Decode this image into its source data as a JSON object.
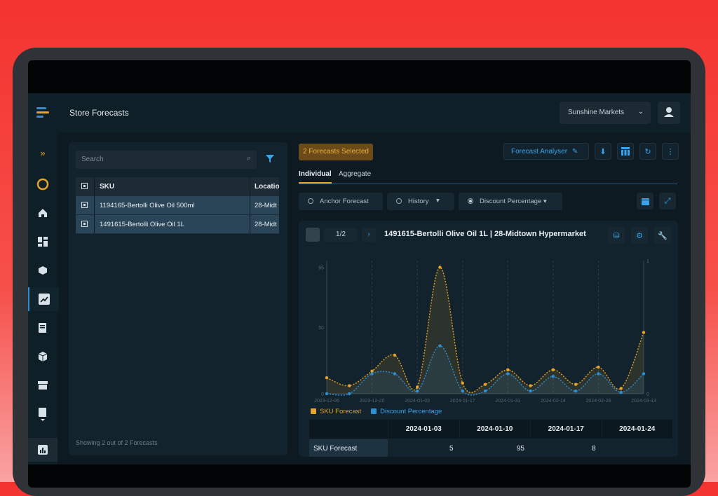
{
  "app": {
    "title": "Store Forecasts",
    "store": "Sunshine Markets"
  },
  "sidebar": {
    "items": [
      "expand-icon",
      "circle-logo-icon",
      "home-icon",
      "dashboard-icon",
      "inventory-icon",
      "forecast-icon",
      "document-icon",
      "box-icon",
      "store-icon",
      "report-icon",
      "analytics-icon"
    ],
    "active": "forecast-icon"
  },
  "left": {
    "search_placeholder": "Search",
    "columns": {
      "sku": "SKU",
      "location": "Locatio"
    },
    "rows": [
      {
        "sku": "1194165-Bertolli Olive Oil 500ml",
        "location": "28-Midt"
      },
      {
        "sku": "1491615-Bertolli Olive Oil 1L",
        "location": "28-Midt"
      }
    ],
    "footer": "Showing 2 out of 2 Forecasts"
  },
  "right": {
    "badge": "2 Forecasts Selected",
    "analyser": "Forecast Analyser",
    "tabs": {
      "individual": "Individual",
      "aggregate": "Aggregate"
    },
    "filters": {
      "anchor": "Anchor Forecast",
      "history": "History",
      "discount": "Discount Percentage"
    },
    "pager": "1/2",
    "chart_title": "1491615-Bertolli Olive Oil 1L | 28-Midtown Hypermarket",
    "legend": {
      "sku": "SKU Forecast",
      "discount": "Discount Percentage"
    },
    "table": {
      "dates": [
        "2024-01-03",
        "2024-01-10",
        "2024-01-17",
        "2024-01-24"
      ],
      "row_label": "SKU Forecast",
      "values": [
        "5",
        "95",
        "8",
        ""
      ]
    }
  },
  "colors": {
    "accent": "#38a4ee",
    "forecast": "#e6a32a",
    "discount": "#2d8fd6",
    "badge_bg": "#6a4a18"
  },
  "chart_data": {
    "type": "line",
    "x": [
      "2023-12-06",
      "2023-12-13",
      "2023-12-20",
      "2023-12-27",
      "2024-01-03",
      "2024-01-10",
      "2024-01-17",
      "2024-01-24",
      "2024-01-31",
      "2024-02-07",
      "2024-02-14",
      "2024-02-21",
      "2024-02-28",
      "2024-03-06",
      "2024-03-13"
    ],
    "x_ticks": [
      "2023-12-06",
      "2023-12-20",
      "2024-01-03",
      "2024-01-17",
      "2024-01-31",
      "2024-02-14",
      "2024-02-28",
      "2024-03-13"
    ],
    "series": [
      {
        "name": "SKU Forecast",
        "axis": "left",
        "values": [
          12,
          6,
          17,
          29,
          5,
          95,
          8,
          7,
          18,
          6,
          18,
          7,
          20,
          4,
          46
        ]
      },
      {
        "name": "Discount Percentage",
        "axis": "right",
        "values": [
          0,
          0,
          0.15,
          0.15,
          0.02,
          0.36,
          0.02,
          0.02,
          0.15,
          0.02,
          0.13,
          0.02,
          0.15,
          0.01,
          0.15
        ]
      }
    ],
    "y_left_ticks": [
      "0",
      "50",
      "95"
    ],
    "y_right_ticks": [
      "0",
      "1"
    ],
    "ylim_left": [
      0,
      100
    ],
    "ylim_right": [
      0,
      1
    ],
    "grid": true,
    "legend_position": "bottom-left"
  }
}
